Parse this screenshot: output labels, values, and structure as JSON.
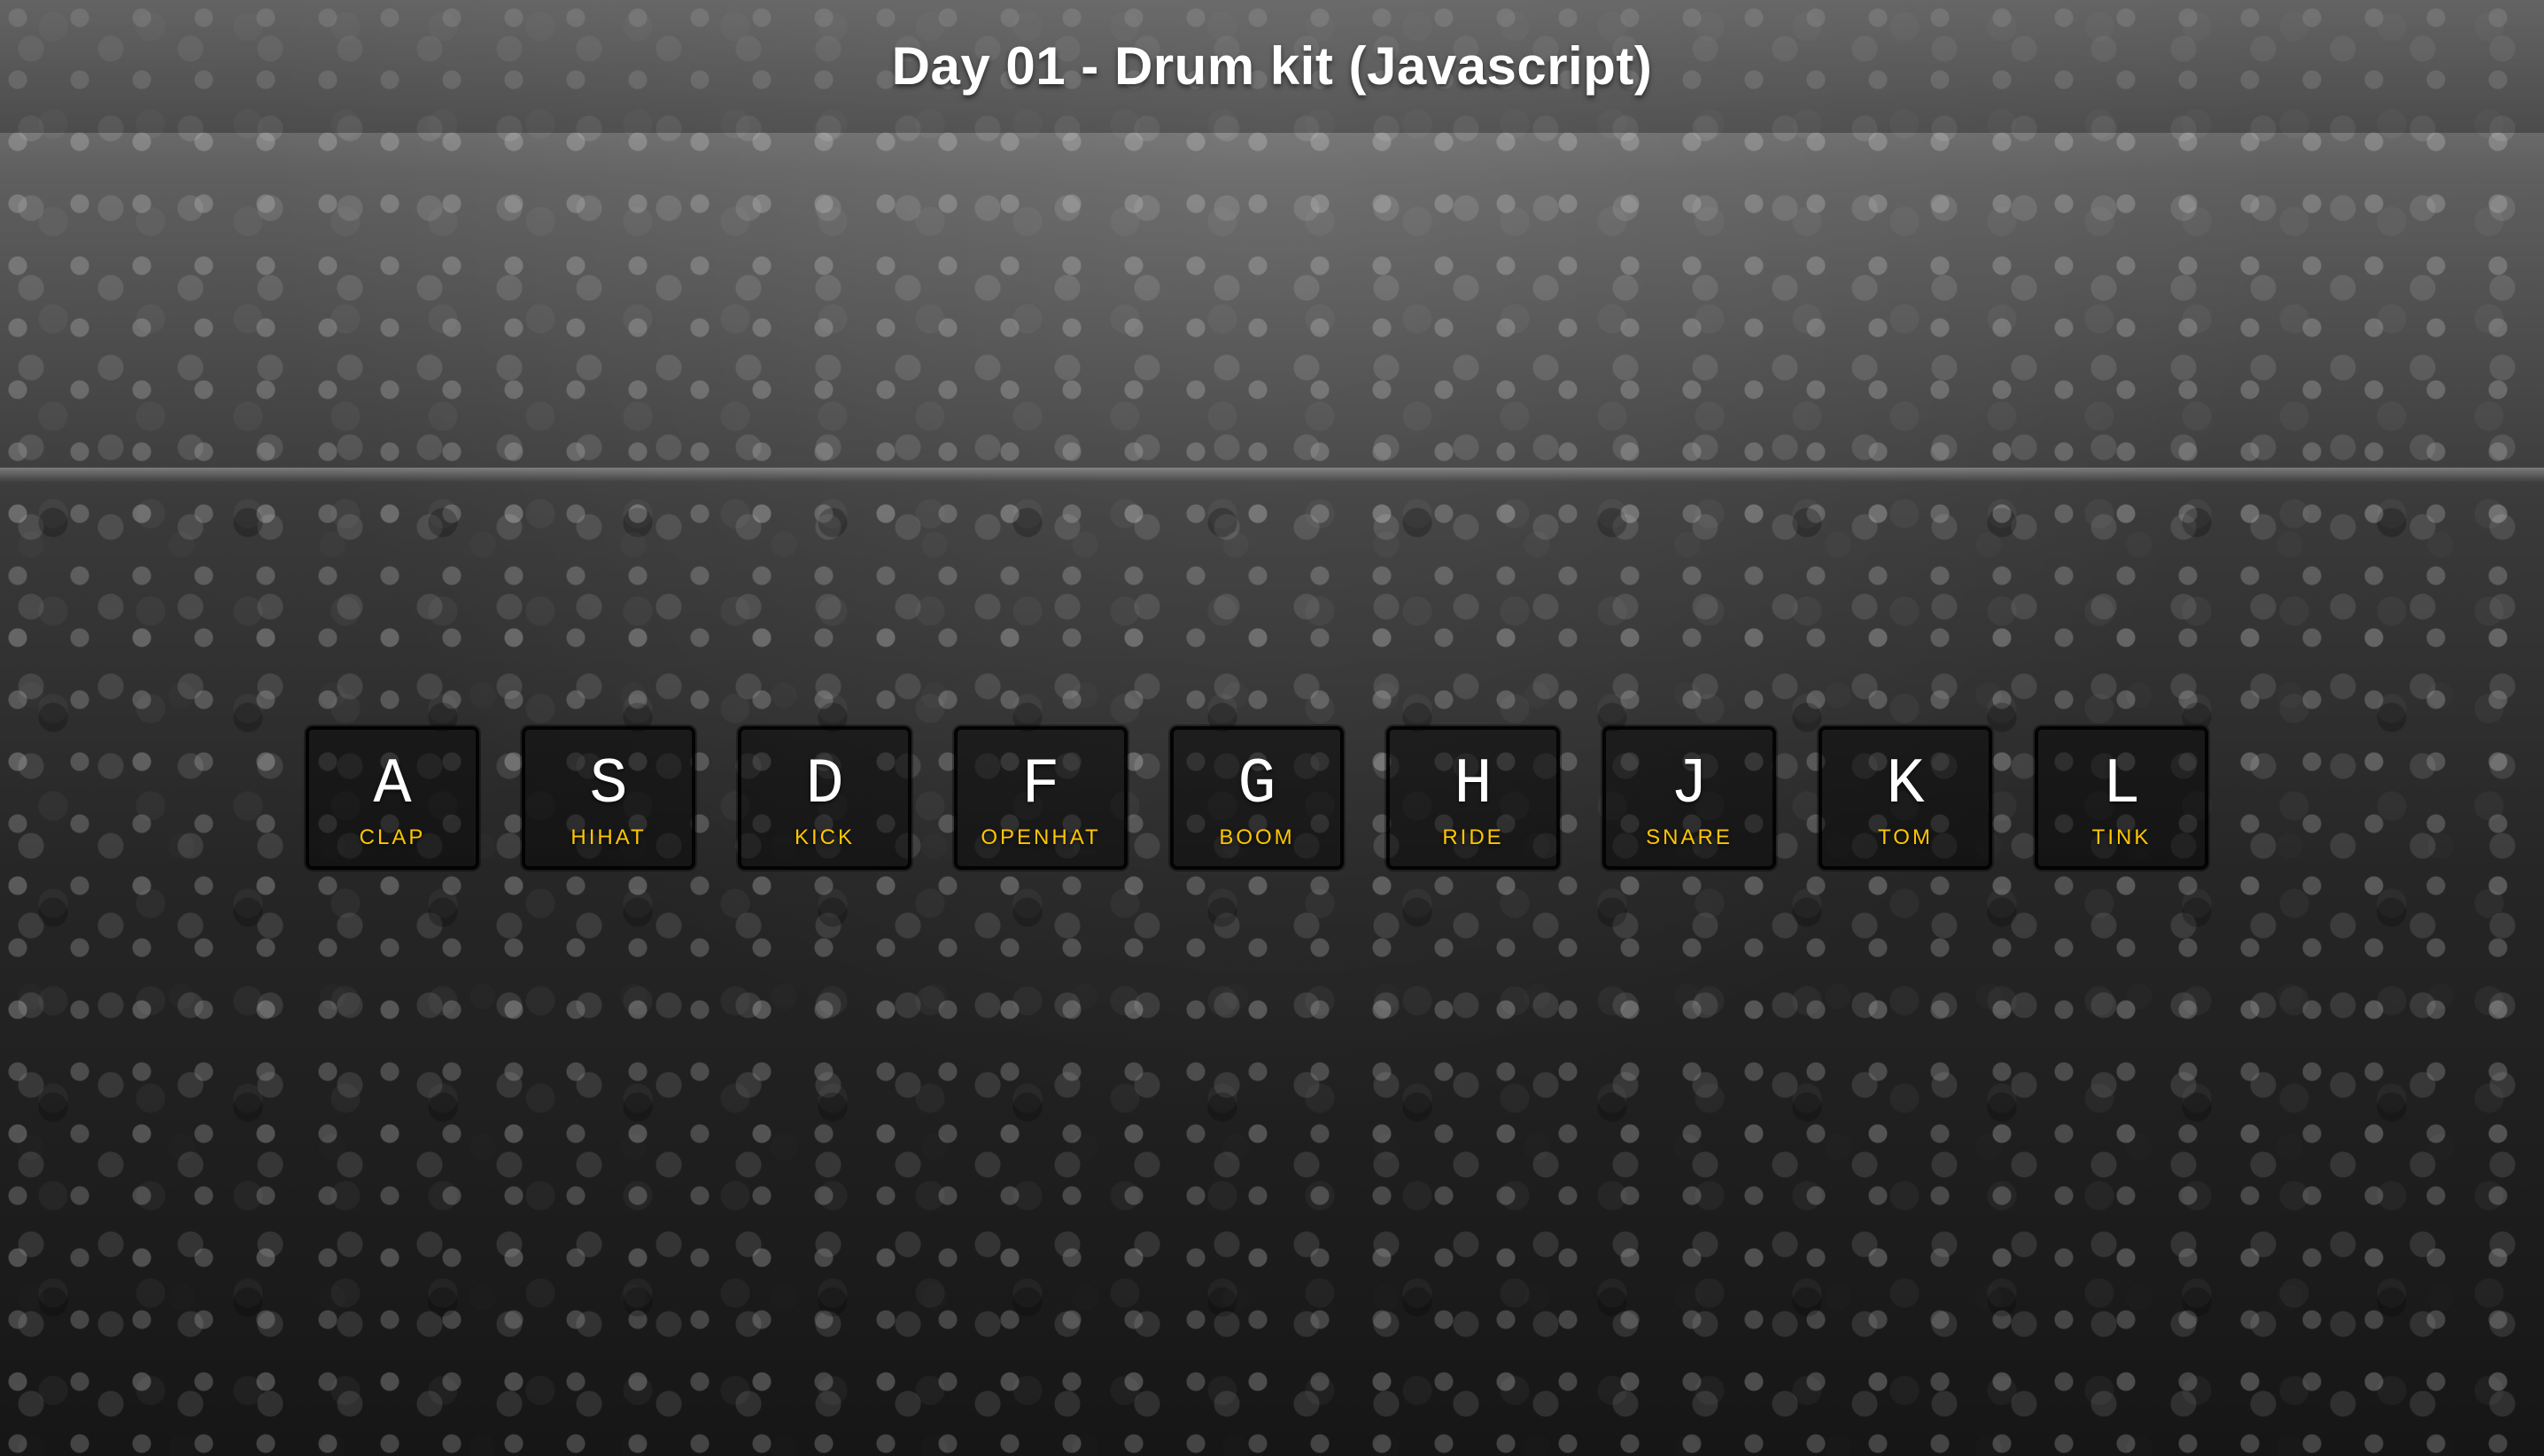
{
  "page": {
    "title": "Day 01 - Drum kit (Javascript)"
  },
  "theme": {
    "accent": "#ffc600",
    "key_letter_color": "#ffffff",
    "background": "grayscale crowd photo"
  },
  "keys": [
    {
      "letter": "A",
      "sound": "CLAP"
    },
    {
      "letter": "S",
      "sound": "HIHAT"
    },
    {
      "letter": "D",
      "sound": "KICK"
    },
    {
      "letter": "F",
      "sound": "OPENHAT"
    },
    {
      "letter": "G",
      "sound": "BOOM"
    },
    {
      "letter": "H",
      "sound": "RIDE"
    },
    {
      "letter": "J",
      "sound": "SNARE"
    },
    {
      "letter": "K",
      "sound": "TOM"
    },
    {
      "letter": "L",
      "sound": "TINK"
    }
  ]
}
